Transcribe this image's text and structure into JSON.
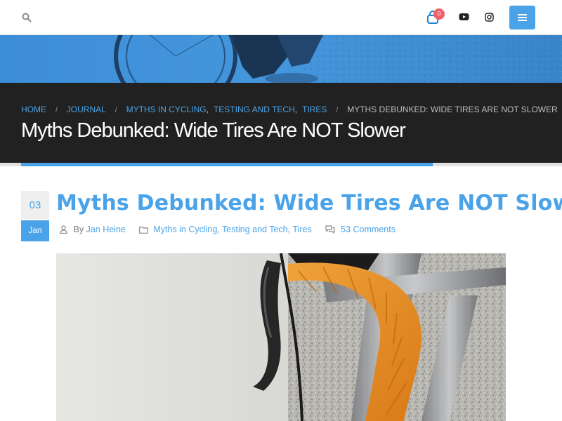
{
  "header": {
    "cart_badge": "0",
    "icons": [
      "search-icon",
      "bag-icon",
      "youtube-icon",
      "instagram-icon",
      "hamburger-icon"
    ]
  },
  "breadcrumb": {
    "home": "Home",
    "journal": "Journal",
    "categories": [
      "Myths in Cycling",
      "Testing and Tech",
      "Tires"
    ],
    "current": "Myths Debunked: Wide Tires Are NOT Slower"
  },
  "page": {
    "title": "Myths Debunked: Wide Tires Are NOT Slower"
  },
  "post": {
    "date_day": "03",
    "date_month": "Jan",
    "title": "Myths Debunked: Wide Tires Are NOT Slower",
    "by_label": "By",
    "author": "Jan Heine",
    "categories": [
      "Myths in Cycling",
      "Testing and Tech",
      "Tires"
    ],
    "comments": "53 Comments"
  },
  "colors": {
    "accent": "#4aa3e8",
    "dark_header": "#212121",
    "badge": "#f0606a",
    "bar_tape": "#e8902a"
  }
}
